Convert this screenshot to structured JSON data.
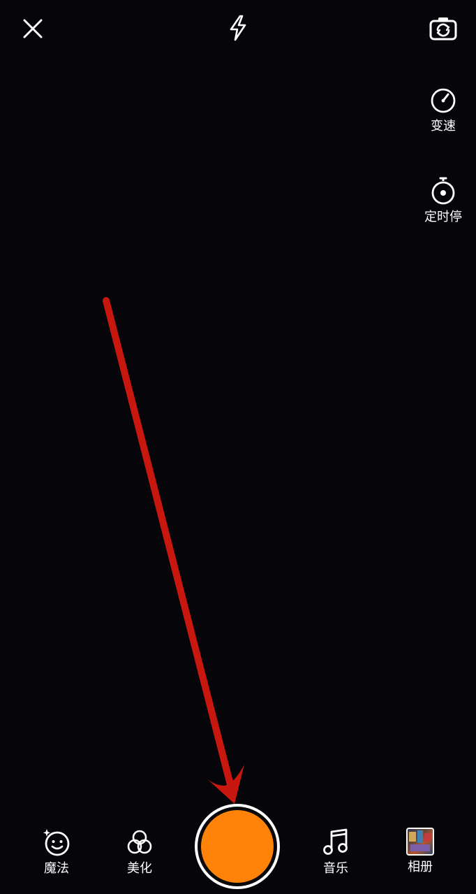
{
  "top_bar": {
    "close_icon": "close-icon",
    "flash_icon": "flash-icon",
    "switch_camera_icon": "switch-camera-icon"
  },
  "side_tools": [
    {
      "label": "变速",
      "icon": "speed-gauge-icon"
    },
    {
      "label": "定时停",
      "icon": "timer-stop-icon"
    }
  ],
  "bottom_tools": {
    "magic": {
      "label": "魔法",
      "icon": "magic-face-icon"
    },
    "beautify": {
      "label": "美化",
      "icon": "beautify-circles-icon"
    },
    "music": {
      "label": "音乐",
      "icon": "music-note-icon"
    },
    "album": {
      "label": "相册",
      "icon": "album-thumbnail"
    }
  },
  "shutter": {
    "icon": "record-button"
  },
  "colors": {
    "background": "#06050a",
    "shutter": "#fe8308",
    "annotation_arrow": "#c8170e",
    "foreground": "#ffffff"
  }
}
